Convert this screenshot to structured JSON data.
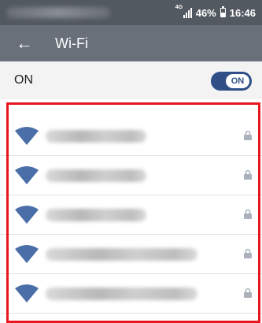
{
  "status_bar": {
    "network_type": "4G",
    "battery_level": "46%",
    "battery_fraction": 0.46,
    "time": "16:46",
    "icons": [
      "signal-icon",
      "battery-icon"
    ]
  },
  "toolbar": {
    "back_icon": "arrow-left-icon",
    "back_glyph": "←",
    "title": "Wi-Fi"
  },
  "master_switch": {
    "label": "ON",
    "toggle_text": "ON",
    "is_on": true
  },
  "networks": [
    {
      "ssid": "",
      "ssid_obscured": true,
      "secured": true,
      "icon": "wifi-icon",
      "lock_icon": "lock-icon"
    },
    {
      "ssid": "",
      "ssid_obscured": true,
      "secured": true,
      "icon": "wifi-icon",
      "lock_icon": "lock-icon"
    },
    {
      "ssid": "",
      "ssid_obscured": true,
      "secured": true,
      "icon": "wifi-icon",
      "lock_icon": "lock-icon"
    },
    {
      "ssid": "",
      "ssid_obscured": true,
      "secured": true,
      "icon": "wifi-icon",
      "lock_icon": "lock-icon"
    },
    {
      "ssid": "",
      "ssid_obscured": true,
      "secured": true,
      "icon": "wifi-icon",
      "lock_icon": "lock-icon"
    }
  ],
  "colors": {
    "status_bar": "#535961",
    "toolbar": "#69707a",
    "master_bg": "#f3f3f3",
    "toggle": "#2f4f86",
    "wifi_icon": "#4a6ea8",
    "lock_icon": "#aab1ba",
    "highlight_box": "#e8161e"
  }
}
